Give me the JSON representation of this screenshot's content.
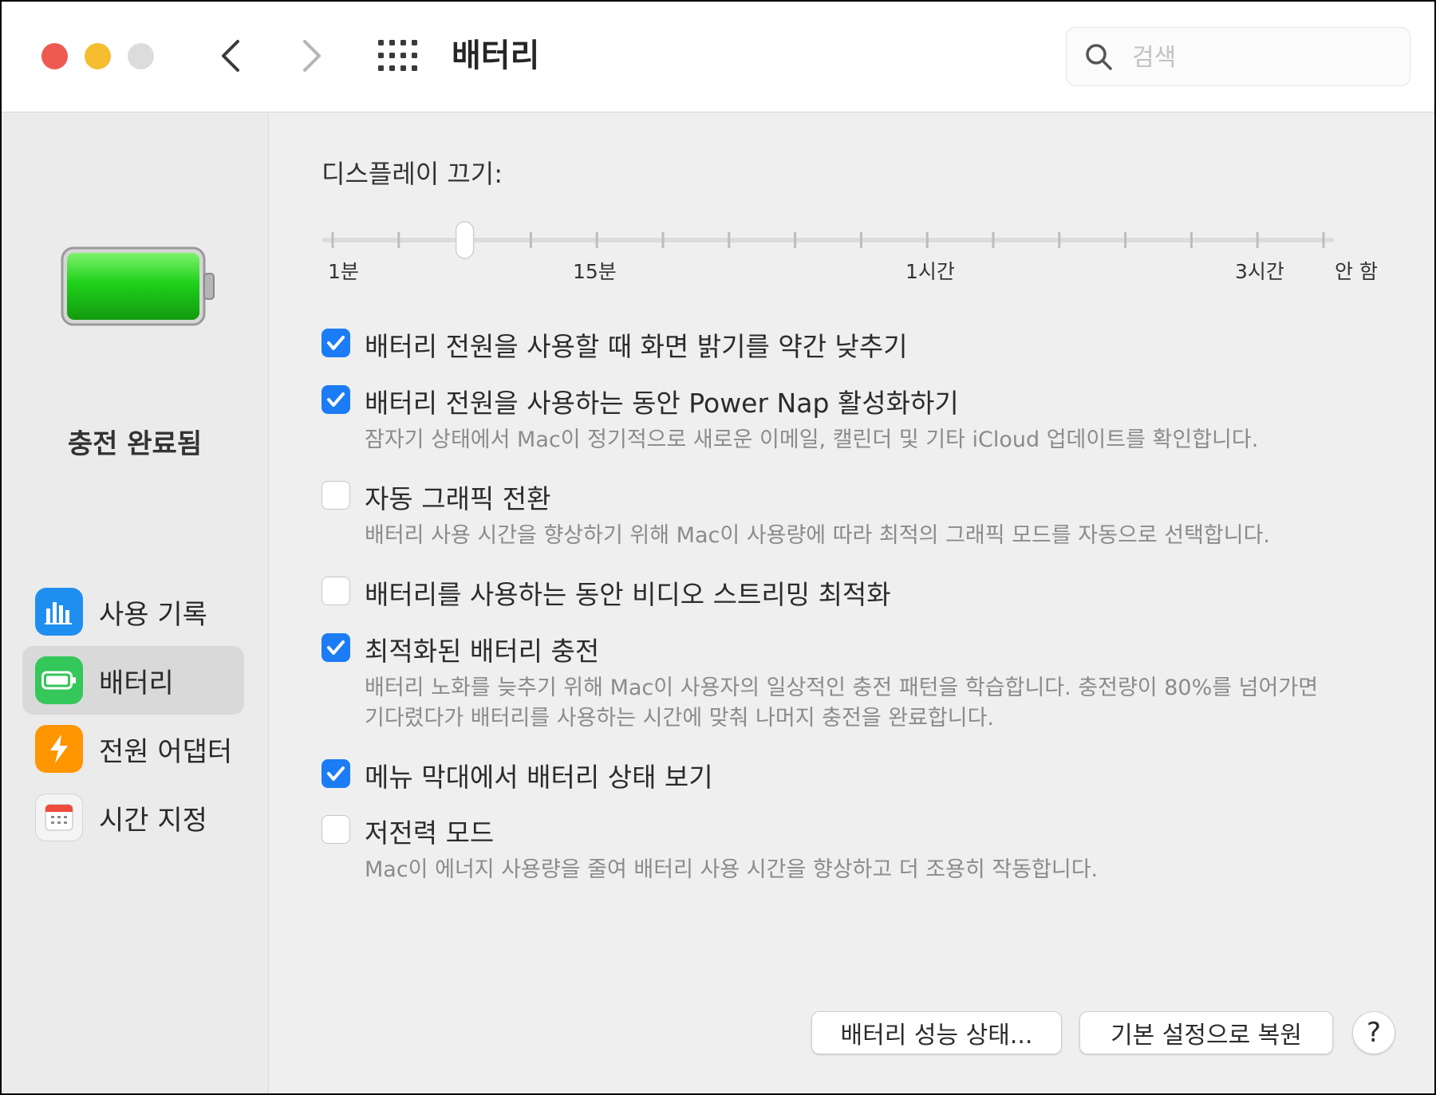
{
  "window": {
    "title": "배터리",
    "search_placeholder": "검색"
  },
  "sidebar": {
    "battery_status": "충전 완료됨",
    "items": [
      {
        "label": "사용 기록",
        "icon": "bar-chart-icon",
        "color": "#1f8ef1"
      },
      {
        "label": "배터리",
        "icon": "battery-icon",
        "color": "#34c759",
        "active": true
      },
      {
        "label": "전원 어댑터",
        "icon": "lightning-bolt-icon",
        "color": "#ff9500"
      },
      {
        "label": "시간 지정",
        "icon": "calendar-icon",
        "color": "#f2f2f2"
      }
    ]
  },
  "display_off": {
    "label": "디스플레이 끄기:",
    "tick_labels": [
      "1분",
      "15분",
      "1시간",
      "3시간",
      "안 함"
    ],
    "tick_count": 16,
    "selected_tick_index": 2
  },
  "options": [
    {
      "label": "배터리 전원을 사용할 때 화면 밝기를 약간 낮추기",
      "checked": true,
      "desc": []
    },
    {
      "label": "배터리 전원을 사용하는 동안 Power Nap 활성화하기",
      "checked": true,
      "desc": [
        "잠자기 상태에서 Mac이 정기적으로 새로운 이메일, 캘린더 및 기타 iCloud 업데이트를 확인합니다."
      ]
    },
    {
      "label": "자동 그래픽 전환",
      "checked": false,
      "desc": [
        "배터리 사용 시간을 향상하기 위해 Mac이 사용량에 따라 최적의 그래픽 모드를 자동으로 선택합니다."
      ]
    },
    {
      "label": "배터리를 사용하는 동안 비디오 스트리밍 최적화",
      "checked": false,
      "desc": []
    },
    {
      "label": "최적화된 배터리 충전",
      "checked": true,
      "desc": [
        "배터리 노화를 늦추기 위해 Mac이 사용자의 일상적인 충전 패턴을 학습합니다. 충전량이 80%를 넘어가면",
        "기다렸다가 배터리를 사용하는 시간에 맞춰 나머지 충전을 완료합니다."
      ]
    },
    {
      "label": "메뉴 막대에서 배터리 상태 보기",
      "checked": true,
      "desc": []
    },
    {
      "label": "저전력 모드",
      "checked": false,
      "desc": [
        "Mac이 에너지 사용량을 줄여 배터리 사용 시간을 향상하고 더 조용히 작동합니다."
      ]
    }
  ],
  "buttons": {
    "battery_health": "배터리 성능 상태...",
    "restore_defaults": "기본 설정으로 복원",
    "help": "?"
  },
  "colors": {
    "accent": "#1b7cf6",
    "battery_green": "#22c71f"
  }
}
